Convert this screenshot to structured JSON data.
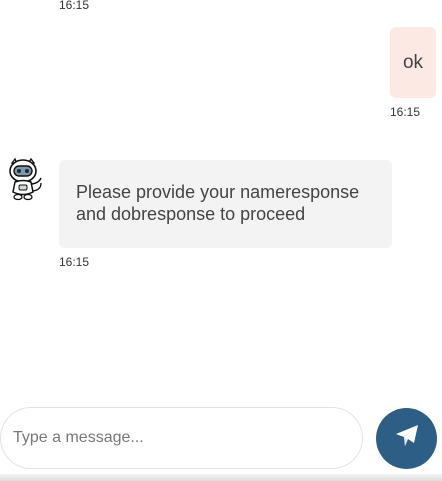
{
  "messages": [
    {
      "sender": "bot",
      "text": "",
      "time": "16:15"
    },
    {
      "sender": "user",
      "text": "ok",
      "time": "16:15"
    },
    {
      "sender": "bot",
      "text": "Please provide your nameresponse and dobresponse to proceed",
      "time": "16:15"
    }
  ],
  "composer": {
    "placeholder": "Type a message...",
    "value": ""
  },
  "icons": {
    "avatar": "robot-avatar-icon",
    "send": "paper-plane-icon"
  },
  "colors": {
    "user_bubble": "#fde9e4",
    "bot_bubble": "#f3f3f3",
    "send_button": "#2d5f86"
  }
}
